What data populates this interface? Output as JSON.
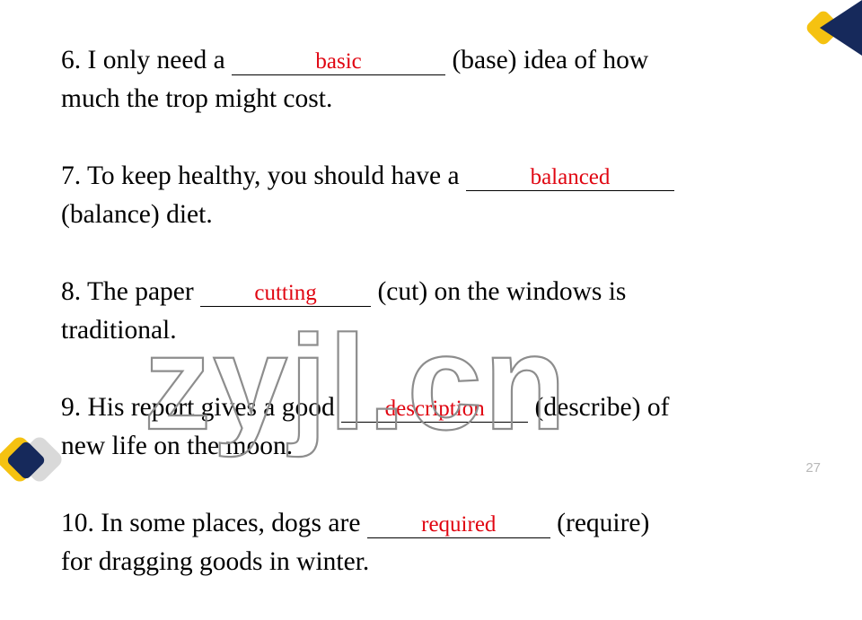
{
  "slide": {
    "page_number": "27",
    "watermark_text": "zyjl.cn",
    "watermark_color": "#8d8d8d",
    "answer_color": "#e00511",
    "text_color": "#000000",
    "background_color": "#ffffff"
  },
  "decor": {
    "navy": "#16295b",
    "gold": "#f5c211",
    "gray": "#d9d9d9",
    "top_right_name": "corner-diamond-top-right",
    "bottom_left_name": "corner-diamond-bottom-left"
  },
  "exercises": [
    {
      "number": "6.",
      "before": "6.  I  only  need  a",
      "answer": "basic",
      "after": "(base)  idea  of  how",
      "tail": "much the trop might cost."
    },
    {
      "number": "7.",
      "before": "7. To keep healthy, you should have a",
      "answer": "balanced",
      "after": "",
      "tail": "(balance) diet."
    },
    {
      "number": "8.",
      "before": "8.  The  paper",
      "answer": "cutting",
      "after": "(cut)  on  the  windows  is",
      "tail": "traditional."
    },
    {
      "number": "9.",
      "before": "9. His report gives a good",
      "answer": "description",
      "after": "(describe) of",
      "tail": "new life on the moon."
    },
    {
      "number": "10.",
      "before": "10.  In  some  places,  dogs  are",
      "answer": "required",
      "after": "(require)",
      "tail": "for dragging goods in winter."
    }
  ]
}
